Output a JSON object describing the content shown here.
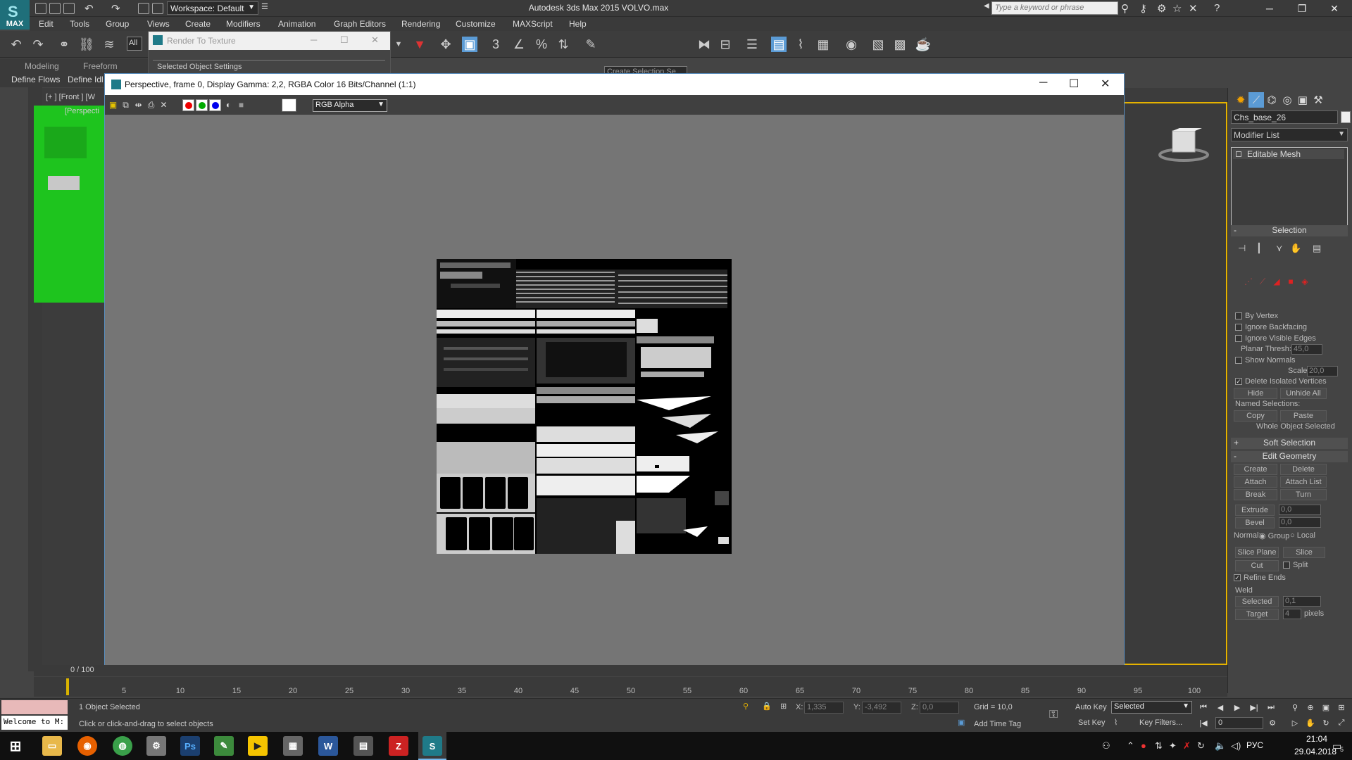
{
  "titlebar": {
    "logo_text": "MAX",
    "workspace": "Workspace: Default",
    "app_title": "Autodesk 3ds Max  2015     VOLVO.max",
    "search_placeholder": "Type a keyword or phrase"
  },
  "menu": [
    "Edit",
    "Tools",
    "Group",
    "Views",
    "Create",
    "Modifiers",
    "Animation",
    "Graph Editors",
    "Rendering",
    "Customize",
    "MAXScript",
    "Help"
  ],
  "toolbar": {
    "selection_filter": "All",
    "selection_set_placeholder": "Create Selection Se"
  },
  "ribbon": {
    "tabs": [
      "Modeling",
      "Freeform"
    ],
    "row2": [
      "Define Flows",
      "Define Idl"
    ]
  },
  "viewport": {
    "label_front": "[+ ] [Front ] [W",
    "label_persp": "[Perspecti"
  },
  "rtt_dialog": {
    "title": "Render To Texture",
    "section": "Selected Object Settings"
  },
  "render_window": {
    "title": "Perspective, frame 0, Display Gamma: 2,2, RGBA Color 16 Bits/Channel (1:1)",
    "channel": "RGB Alpha"
  },
  "command_panel": {
    "object_name": "Chs_base_26",
    "modifier_list": "Modifier List",
    "stack_item": "Editable Mesh",
    "selection": {
      "header": "Selection",
      "by_vertex": "By Vertex",
      "ignore_backfacing": "Ignore Backfacing",
      "ignore_visible_edges": "Ignore Visible Edges",
      "planar_thresh_label": "Planar Thresh:",
      "planar_thresh": "45,0",
      "show_normals": "Show Normals",
      "scale_label": "Scale:",
      "scale": "20,0",
      "delete_isolated": "Delete Isolated Vertices",
      "delete_isolated_checked": true,
      "hide": "Hide",
      "unhide_all": "Unhide All",
      "named_selections": "Named Selections:",
      "copy": "Copy",
      "paste": "Paste",
      "status": "Whole Object Selected"
    },
    "soft_selection": "Soft Selection",
    "edit_geometry": {
      "header": "Edit Geometry",
      "create": "Create",
      "delete": "Delete",
      "attach": "Attach",
      "attach_list": "Attach List",
      "break": "Break",
      "turn": "Turn",
      "extrude": "Extrude",
      "extrude_val": "0,0",
      "bevel": "Bevel",
      "bevel_val": "0,0",
      "normal": "Normal:",
      "group": "Group",
      "local": "Local",
      "slice_plane": "Slice Plane",
      "slice": "Slice",
      "cut": "Cut",
      "split": "Split",
      "refine_ends": "Refine Ends",
      "weld": "Weld",
      "selected": "Selected",
      "selected_val": "0,1",
      "target": "Target",
      "target_val": "4",
      "pixels": "pixels"
    }
  },
  "timeline": {
    "frame_label": "0 / 100",
    "ticks": [
      "5",
      "10",
      "15",
      "20",
      "25",
      "30",
      "35",
      "40",
      "45",
      "50",
      "55",
      "60",
      "65",
      "70",
      "75",
      "80",
      "85",
      "90",
      "95",
      "100"
    ]
  },
  "statusbar": {
    "welcome": "Welcome to M:",
    "objects_selected": "1 Object Selected",
    "prompt": "Click or click-and-drag to select objects",
    "x_label": "X:",
    "x_val": "1,335",
    "y_label": "Y:",
    "y_val": "-3,492",
    "z_label": "Z:",
    "z_val": "0,0",
    "grid": "Grid = 10,0",
    "add_time_tag": "Add Time Tag",
    "auto_key": "Auto Key",
    "set_key": "Set Key",
    "selected_dd": "Selected",
    "key_filters": "Key Filters...",
    "frame": "0"
  },
  "taskbar": {
    "time": "21:04",
    "date": "29.04.2018",
    "lang": "РУС",
    "notif_count": "5"
  },
  "colors": {
    "accent": "#e5b200",
    "render_bg": "#757575",
    "viewport_green": "#1ec41e"
  }
}
